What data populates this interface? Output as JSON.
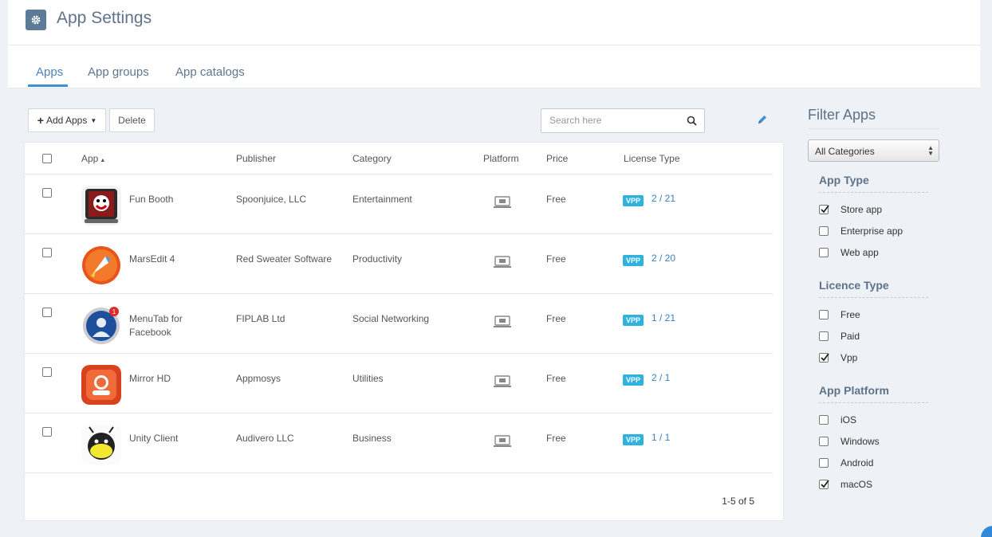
{
  "header": {
    "title": "App Settings"
  },
  "tabs": [
    {
      "label": "Apps",
      "active": true
    },
    {
      "label": "App groups",
      "active": false
    },
    {
      "label": "App catalogs",
      "active": false
    }
  ],
  "toolbar": {
    "add_label": "Add Apps",
    "delete_label": "Delete"
  },
  "search": {
    "placeholder": "Search here"
  },
  "table": {
    "columns": {
      "app": "App",
      "publisher": "Publisher",
      "category": "Category",
      "platform": "Platform",
      "price": "Price",
      "license": "License Type"
    },
    "rows": [
      {
        "name": "Fun Booth",
        "publisher": "Spoonjuice, LLC",
        "category": "Entertainment",
        "price": "Free",
        "badge": "VPP",
        "license": "2 / 21",
        "icon": "fun-booth-icon"
      },
      {
        "name": "MarsEdit 4",
        "publisher": "Red Sweater Software",
        "category": "Productivity",
        "price": "Free",
        "badge": "VPP",
        "license": "2 / 20",
        "icon": "marsedit-icon"
      },
      {
        "name": "MenuTab for Facebook",
        "publisher": "FIPLAB Ltd",
        "category": "Social Networking",
        "price": "Free",
        "badge": "VPP",
        "license": "1 / 21",
        "icon": "menutab-icon"
      },
      {
        "name": "Mirror HD",
        "publisher": "Appmosys",
        "category": "Utilities",
        "price": "Free",
        "badge": "VPP",
        "license": "2 / 1",
        "icon": "mirror-hd-icon"
      },
      {
        "name": "Unity Client",
        "publisher": "Audivero LLC",
        "category": "Business",
        "price": "Free",
        "badge": "VPP",
        "license": "1 / 1",
        "icon": "unity-client-icon"
      }
    ],
    "pagination": "1-5 of 5"
  },
  "filters": {
    "title": "Filter Apps",
    "category_select": "All Categories",
    "app_type": {
      "title": "App Type",
      "items": [
        {
          "label": "Store app",
          "checked": true
        },
        {
          "label": "Enterprise app",
          "checked": false
        },
        {
          "label": "Web app",
          "checked": false
        }
      ]
    },
    "licence_type": {
      "title": "Licence Type",
      "items": [
        {
          "label": "Free",
          "checked": false
        },
        {
          "label": "Paid",
          "checked": false
        },
        {
          "label": "Vpp",
          "checked": true
        }
      ]
    },
    "app_platform": {
      "title": "App Platform",
      "items": [
        {
          "label": "iOS",
          "checked": false
        },
        {
          "label": "Windows",
          "checked": false
        },
        {
          "label": "Android",
          "checked": false
        },
        {
          "label": "macOS",
          "checked": true
        }
      ]
    }
  },
  "colors": {
    "accent": "#3d8fd6",
    "badge": "#2fb2de",
    "title": "#5e7289"
  }
}
